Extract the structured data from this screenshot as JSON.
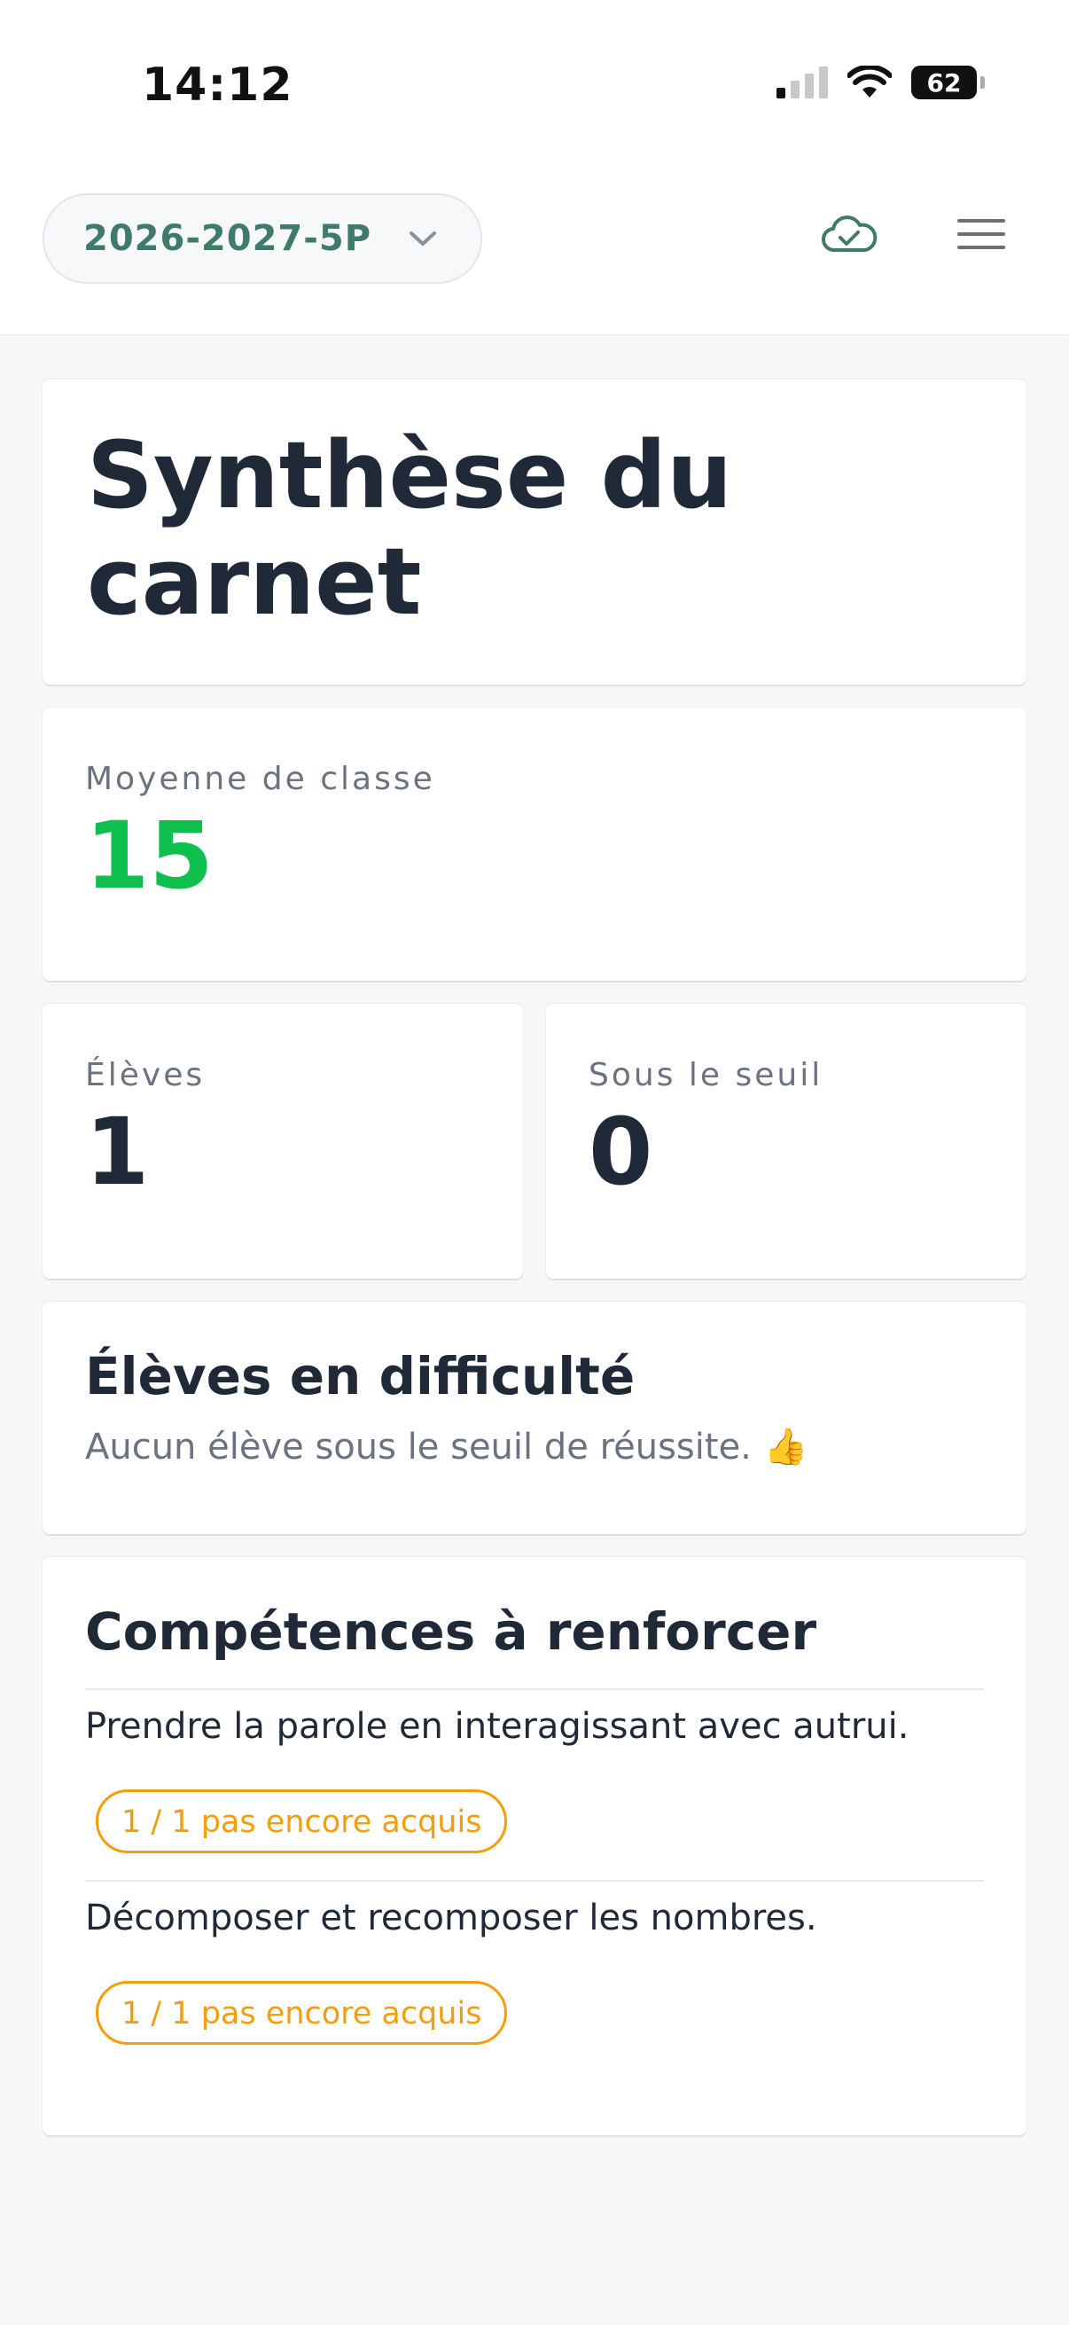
{
  "status_bar": {
    "time": "14:12",
    "battery": "62"
  },
  "header": {
    "class_selector": "2026-2027-5P",
    "icons": [
      "chevron-down-icon",
      "cloud-check-icon",
      "menu-icon"
    ]
  },
  "page": {
    "title": "Synthèse du carnet"
  },
  "metrics": {
    "class_average": {
      "label": "Moyenne de classe",
      "value": "15"
    },
    "students": {
      "label": "Élèves",
      "value": "1"
    },
    "below_threshold": {
      "label": "Sous le seuil",
      "value": "0"
    }
  },
  "difficulty": {
    "title": "Élèves en difficulté",
    "message": "Aucun élève sous le seuil de réussite.",
    "emoji": "👍"
  },
  "skills": {
    "title": "Compétences à renforcer",
    "items": [
      {
        "name": "Prendre la parole en interagissant avec autrui.",
        "badge": "1 / 1 pas encore acquis"
      },
      {
        "name": "Décomposer et recomposer les nombres.",
        "badge": "1 / 1 pas encore acquis"
      }
    ]
  },
  "colors": {
    "accent_green": "#3f7a6a",
    "success_green": "#0fbf4d",
    "warning_orange": "#f59e0b"
  }
}
